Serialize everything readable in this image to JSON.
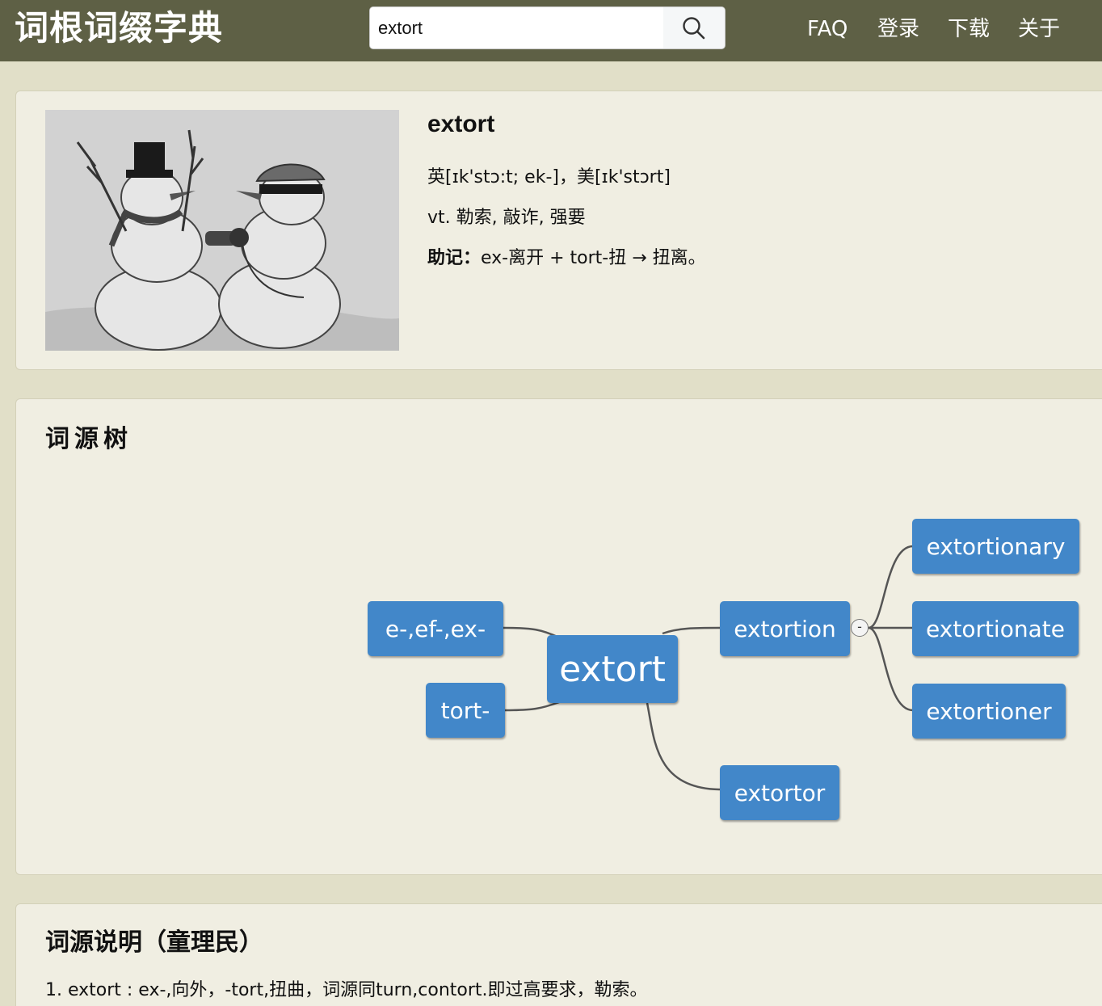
{
  "site": {
    "logo": "词根词缀字典"
  },
  "search": {
    "value": "extort"
  },
  "nav": {
    "faq": "FAQ",
    "login": "登录",
    "download": "下载",
    "about": "关于"
  },
  "entry": {
    "word": "extort",
    "pronunciation": "英[ɪk'stɔ:t; ek-]，美[ɪk'stɔrt]",
    "meaning": "vt. 勒索, 敲诈, 强要",
    "mnemonic_label": "助记：",
    "mnemonic_text": "ex-离开 + tort-扭 → 扭离。"
  },
  "tree": {
    "title": "词源树",
    "root": "extort",
    "left_nodes": [
      "e-,ef-,ex-",
      "tort-"
    ],
    "extortion": "extortion",
    "extortion_children": [
      "extortionary",
      "extortionate",
      "extortioner"
    ],
    "extortor": "extortor",
    "toggle": "-"
  },
  "etymology": {
    "title": "词源说明（童理民）",
    "line1": "1. extort : ex-,向外，-tort,扭曲，词源同turn,contort.即过高要求，勒索。"
  },
  "colors": {
    "header": "#5e6045",
    "background": "#e1dfc8",
    "card": "#f0eee2",
    "node": "#4287c9"
  }
}
